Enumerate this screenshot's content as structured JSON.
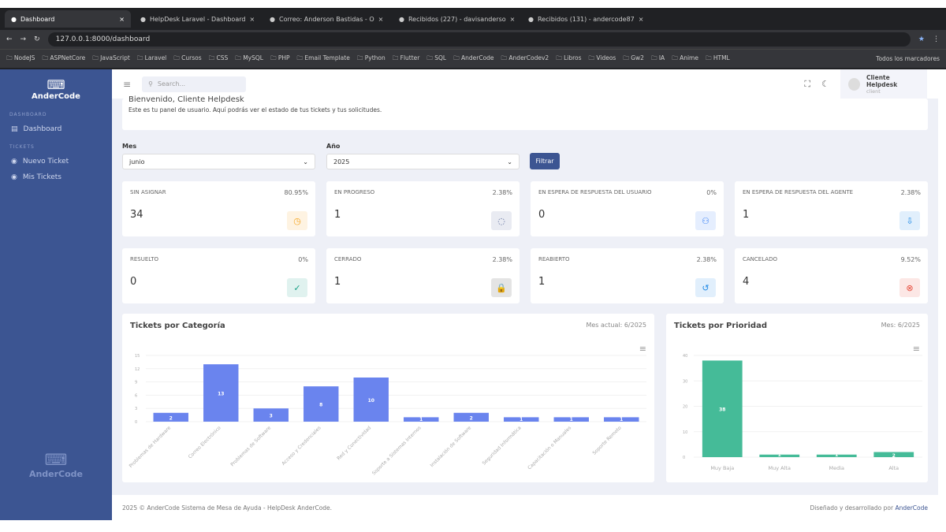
{
  "browser": {
    "tabs": [
      "Dashboard",
      "HelpDesk Laravel - Dashboard",
      "Correo: Anderson Bastidas - O",
      "Recibidos (227) - davisanderso",
      "Recibidos (131) - andercode87"
    ],
    "url": "127.0.0.1:8000/dashboard",
    "bookmarks": [
      "NodeJS",
      "ASPNetCore",
      "JavaScript",
      "Laravel",
      "Cursos",
      "CSS",
      "MySQL",
      "PHP",
      "Email Template",
      "Python",
      "Flutter",
      "SQL",
      "AnderCode",
      "AnderCodev2",
      "Libros",
      "Videos",
      "Gw2",
      "IA",
      "Anime",
      "HTML"
    ],
    "all_bookmarks": "Todos los marcadores"
  },
  "sidebar": {
    "brand": "AnderCode",
    "sections": [
      "DASHBOARD",
      "TICKETS"
    ],
    "items": [
      "Dashboard",
      "Nuevo Ticket",
      "Mis Tickets"
    ],
    "footer_brand": "AnderCode"
  },
  "header": {
    "search_placeholder": "Search...",
    "user_name": "Cliente Helpdesk",
    "user_role": "client"
  },
  "welcome": {
    "title": "Bienvenido, Cliente Helpdesk",
    "text": "Este es tu panel de usuario. Aquí podrás ver el estado de tus tickets y tus solicitudes."
  },
  "filters": {
    "month_label": "Mes",
    "month_value": "junio",
    "year_label": "Año",
    "year_value": "2025",
    "button": "Filtrar"
  },
  "stats": [
    {
      "title": "SIN ASIGNAR",
      "percent": "80.95%",
      "value": "34",
      "icon": "clock-icon",
      "color": "#f5a623"
    },
    {
      "title": "EN PROGRESO",
      "percent": "2.38%",
      "value": "1",
      "icon": "spinner-icon",
      "color": "#5a6a9a"
    },
    {
      "title": "EN ESPERA DE RESPUESTA DEL USUARIO",
      "percent": "0%",
      "value": "0",
      "icon": "user-voice-icon",
      "color": "#3b82f6"
    },
    {
      "title": "EN ESPERA DE RESPUESTA DEL AGENTE",
      "percent": "2.38%",
      "value": "1",
      "icon": "download-icon",
      "color": "#1e88e5"
    },
    {
      "title": "RESUELTO",
      "percent": "0%",
      "value": "0",
      "icon": "check-circle-icon",
      "color": "#16a085"
    },
    {
      "title": "CERRADO",
      "percent": "2.38%",
      "value": "1",
      "icon": "lock-icon",
      "color": "#333333"
    },
    {
      "title": "REABIERTO",
      "percent": "2.38%",
      "value": "1",
      "icon": "history-icon",
      "color": "#1e88e5"
    },
    {
      "title": "CANCELADO",
      "percent": "9.52%",
      "value": "4",
      "icon": "x-circle-icon",
      "color": "#e74c3c"
    }
  ],
  "chart_data": [
    {
      "type": "bar",
      "title": "Tickets por Categoría",
      "subtitle": "Mes actual: 6/2025",
      "categories": [
        "Problemas de Hardware",
        "Correo Electrónico",
        "Problemas de Software",
        "Acceso y Credenciales",
        "Red y Conectividad",
        "Soporte a Sistemas Internos",
        "Instalación de Software",
        "Seguridad Informática",
        "Capacitación o Manuales",
        "Soporte Remoto"
      ],
      "values": [
        2,
        13,
        3,
        8,
        10,
        1,
        2,
        1,
        1,
        1
      ],
      "ylim": [
        0,
        15
      ],
      "yticks": [
        0,
        3,
        6,
        9,
        12,
        15
      ],
      "color": "#6a84ee"
    },
    {
      "type": "bar",
      "title": "Tickets por Prioridad",
      "subtitle": "Mes: 6/2025",
      "categories": [
        "Muy Baja",
        "Muy Alta",
        "Media",
        "Alta"
      ],
      "values": [
        38,
        1,
        1,
        2
      ],
      "ylim": [
        0,
        40
      ],
      "yticks": [
        0,
        10,
        20,
        30,
        40
      ],
      "color": "#45bb98"
    }
  ],
  "footer": {
    "left": "2025 © AnderCode Sistema de Mesa de Ayuda - HelpDesk AnderCode.",
    "right_prefix": "Diseñado y desarrollado por",
    "right_link": "AnderCode"
  }
}
